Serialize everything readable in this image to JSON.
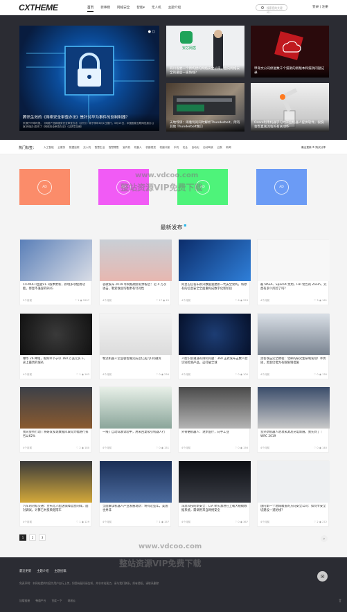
{
  "header": {
    "logo": "CXTHEME",
    "nav": [
      "首页",
      "新事物",
      "网络安全",
      "智能",
      "无人机",
      "主题介绍"
    ],
    "search_placeholder": "搜索您的关键词...",
    "auth": "登录 | 注册"
  },
  "hero": {
    "big": {
      "title": "腾讯生效的《网络安全审查办法》是针对华为事件的反制利器？",
      "summary": "来源于环球时报，《网络产品和服务安全审查办法（试行）》将于明年6月1日施行，6月15日，中国国家互联网信息办公室(网信办)发布了《网络安全审查办法》（征求意见稿）"
    },
    "cards": [
      {
        "title": "四川省委一个新构建的网络安全公司，面向网络安全的最后一道防线？"
      },
      {
        "title": "甲骨文公司修复数千个漏洞的新版本和漏洞问题记录"
      },
      {
        "title": "天地悖谬：闹着玩的同时解析Thunderbolt，所有其他 Thunderbolt端口"
      },
      {
        "title": "Osaro利用机器学习为工业机器人提供软件，很快会帮直观流程的有关动作"
      }
    ]
  },
  "tags": {
    "label": "热门标签：",
    "items": [
      "人工智能",
      "云服务",
      "数据追踪",
      "无人机",
      "智慧生活",
      "智慧零售",
      "室内机",
      "机器人",
      "机器视觉",
      "机器代客",
      "手机",
      "安全",
      "自动化",
      "自动驾驶",
      "云数",
      "新闻"
    ],
    "right": "最近更新  ⚑ 购买分享"
  },
  "ads": [
    {
      "label": "AD",
      "color": "#fb8c6a"
    },
    {
      "label": "AD",
      "color": "#f15bf5"
    },
    {
      "label": "AD",
      "color": "#4ef37a"
    },
    {
      "label": "AD",
      "color": "#6b9bf5"
    }
  ],
  "watermark": {
    "url": "www.vdcoo.com",
    "text": "整站资源VIP免费下载"
  },
  "section_title": "最新发布",
  "posts": [
    {
      "title": "CX-MULTI主题V1.1版本更新，新增多项使用功能，修复不兼容的BUG",
      "time": "3个月前",
      "likes": "1",
      "views": "2997"
    },
    {
      "title": "谷歌发布 2019 年网络勒索软件报告：近 4 万次攻击，勒索收益均衡更有针对性",
      "time": "4个月前",
      "likes": "17",
      "views": "45"
    },
    {
      "title": "阿里巴巴发布新兴数据重建新一代安全架构，将原有的信息安全全面重构成数字化新阶段",
      "time": "4个月前",
      "likes": "6",
      "views": "253"
    },
    {
      "title": "被 NASA、SpaceX 禁用，FBI 警告的 Zoom，究竟有多少风险了吗？",
      "time": "4个月前",
      "likes": "3",
      "views": "161"
    },
    {
      "title": "曝华 26 种组，假如环节于以 160 万美元买下，史上最贵的域名",
      "time": "4个月前",
      "likes": "1",
      "views": "163"
    },
    {
      "title": "物流机器人企业极智嘉完成近亿美元C轮融资",
      "time": "4个月前",
      "likes": "0",
      "views": "234"
    },
    {
      "title": "人脸识别遭遇有限制问题：360 正式发布五数人脸识别检测产品，这打破全球",
      "time": "4个月前",
      "likes": "0",
      "views": "100"
    },
    {
      "title": "黑客攻击完全教程：北邮的研究生研制发现！手势短，黑客仍需为有限限制措施",
      "time": "4个月前",
      "likes": "0",
      "views": "130"
    },
    {
      "title": "我司会所行动丨将研发发现数据库取得大幅进行排名以62%",
      "time": "4个月前",
      "likes": "2",
      "views": "180"
    },
    {
      "title": "一线丨自动驾驶试验中，用来回复吸引机器人行",
      "time": "4个月前",
      "likes": "0",
      "views": "151"
    },
    {
      "title": "外骨骼机器人：进步医疗，向手工业",
      "time": "4个月前",
      "likes": "0",
      "views": "156"
    },
    {
      "title": "室外新机器人进攻来源及充电新展，我先到了｜WRC 2019",
      "time": "4个月前",
      "likes": "0",
      "views": "140"
    },
    {
      "title": "汽车的对标交通：宣布无人配送保障运营同样，面对调试，计算它并反映越南车",
      "time": "4个月前",
      "likes": "1",
      "views": "129"
    },
    {
      "title": "全面解读机器人产业发展现状：将有近些年，美国也并非",
      "time": "4个月前",
      "likes": "1",
      "views": "157"
    },
    {
      "title": "深思科技的新安全：CIA 牵头激进在上载大规模数据系统，需调用来自网络安全",
      "time": "4个月前",
      "likes": "0",
      "views": "367"
    },
    {
      "title": "国内第一个地域覆盖的方向安全公司：如何专安全切建设一道防线？",
      "time": "4个月前",
      "likes": "2",
      "views": "272"
    }
  ],
  "pagination": {
    "pages": [
      "1",
      "2",
      "3"
    ],
    "next": "›"
  },
  "footer": {
    "links": [
      "最近更新",
      "主题介绍",
      "主题投稿"
    ],
    "statement": "免责声明：本网站提供内容为用户自行上传，如您有疑问请告知，并非本站观点，请与我们联系，如有侵权，请联系删除",
    "friends": [
      "加载链接",
      "畅通平台",
      "百度一下",
      "网易云"
    ],
    "mail_icon": "mail-icon"
  }
}
